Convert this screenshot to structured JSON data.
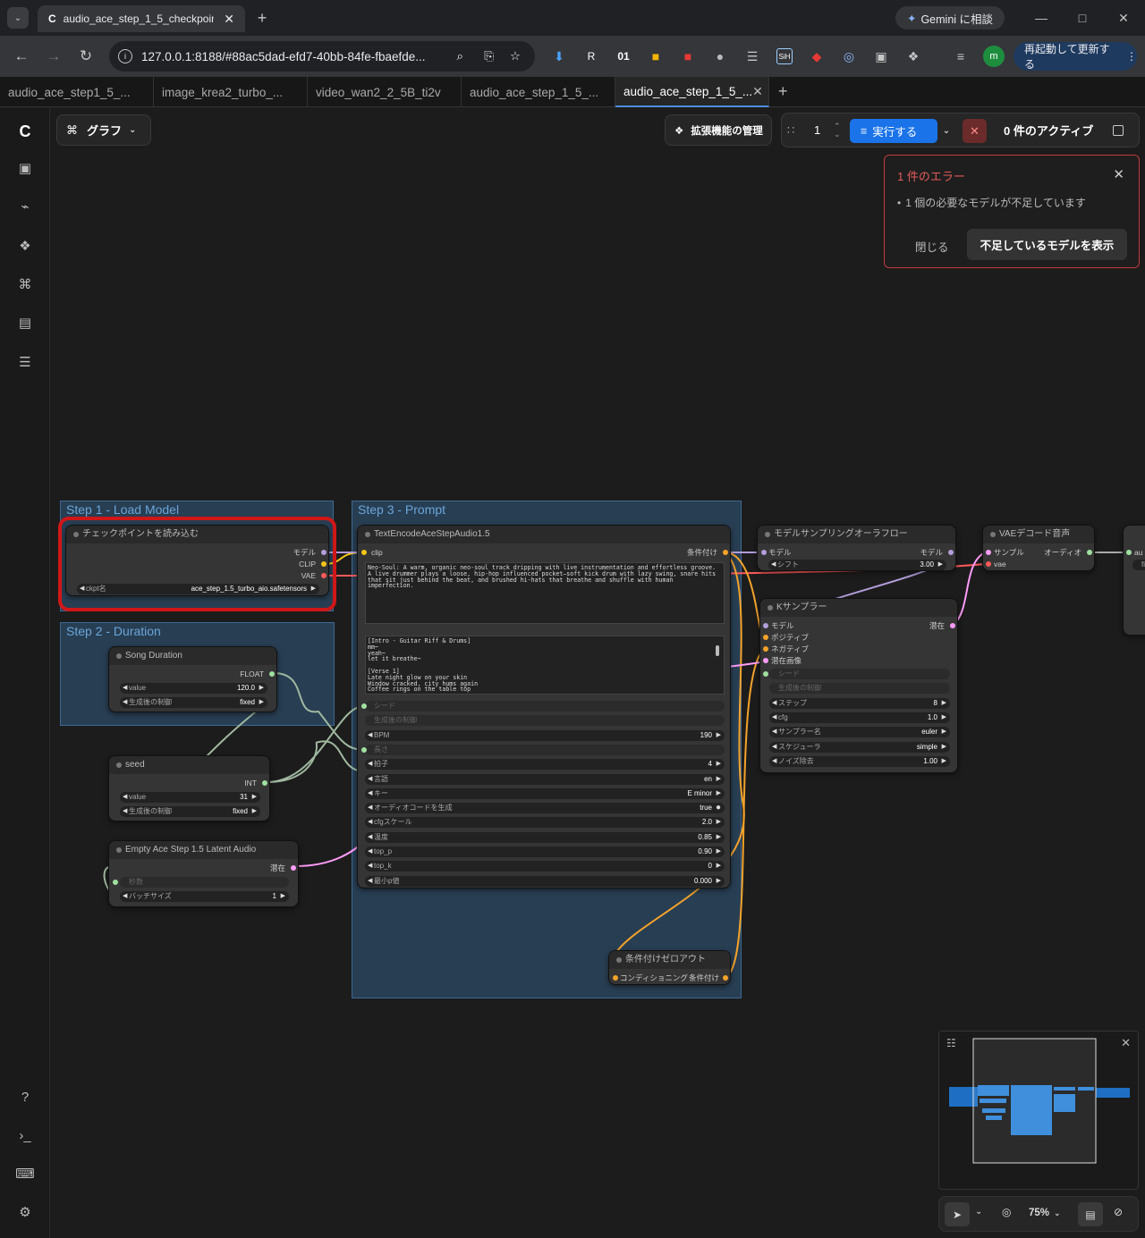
{
  "browser": {
    "tabs": [
      {
        "title": "audio_ace_step_1_5_checkpoint"
      }
    ],
    "new_tab": "+",
    "gemini_label": "Gemini に相談",
    "url": "127.0.0.1:8188/#88ac5dad-efd7-40bb-84fe-fbaefde...",
    "restart_label": "再起動して更新する",
    "profile_initial": "m",
    "ext_label_01": "01",
    "ext_label_sih": "SiH"
  },
  "workflow_tabs": [
    {
      "label": "audio_ace_step1_5_..."
    },
    {
      "label": "image_krea2_turbo_..."
    },
    {
      "label": "video_wan2_2_5B_ti2v"
    },
    {
      "label": "audio_ace_step_1_5_..."
    },
    {
      "label": "audio_ace_step_1_5_..."
    }
  ],
  "topbar": {
    "graph_label": "グラフ",
    "extensions_label": "拡張機能の管理",
    "batch_count": "1",
    "run_label": "実行する",
    "active_label": "0 件のアクティブ"
  },
  "error_panel": {
    "title": "1 件のエラー",
    "message": "1 個の必要なモデルが不足しています",
    "close_label": "閉じる",
    "show_label": "不足しているモデルを表示"
  },
  "groups": {
    "load_model": "Step 1 - Load Model",
    "duration": "Step 2 - Duration",
    "prompt": "Step 3 - Prompt"
  },
  "nodes": {
    "checkpoint": {
      "title": "チェックポイントを読み込む",
      "out_model": "モデル",
      "out_clip": "CLIP",
      "out_vae": "VAE",
      "ckpt_label": "ckpt名",
      "ckpt_value": "ace_step_1.5_turbo_aio.safetensors"
    },
    "song_duration": {
      "title": "Song Duration",
      "out": "FLOAT",
      "value_label": "value",
      "value": "120.0",
      "control_label": "生成後の制御",
      "control_value": "fixed"
    },
    "seed": {
      "title": "seed",
      "out": "INT",
      "value_label": "value",
      "value": "31",
      "control_label": "生成後の制御",
      "control_value": "fixed"
    },
    "latent": {
      "title": "Empty Ace Step 1.5 Latent Audio",
      "out": "潜在",
      "seconds_label": "秒数",
      "batch_label": "バッチサイズ",
      "batch_value": "1"
    },
    "text_encode": {
      "title": "TextEncodeAceStepAudio1.5",
      "in_clip": "clip",
      "out": "条件付け",
      "tags": "Neo-Soul: A warm, organic neo-soul track dripping with live instrumentation and effortless groove. A live drummer plays a loose, hip-hop influenced pocket—soft kick drum with lazy swing, snare hits that sit just behind the beat, and brushed hi-hats that breathe and shuffle with human imperfection.",
      "lyrics": "[Intro - Guitar Riff & Drums]\nmm~\nyeah~\nlet it breathe~\n\n[Verse 1]\nLate night glow on your skin\nWindow cracked, city hums again\nCoffee rings on the table top",
      "widgets": [
        {
          "label": "シード",
          "value": "",
          "dim": true
        },
        {
          "label": "生成後の制御",
          "value": "",
          "dim": true
        },
        {
          "label": "BPM",
          "value": "190"
        },
        {
          "label": "長さ",
          "value": "",
          "dim": true
        },
        {
          "label": "拍子",
          "value": "4"
        },
        {
          "label": "言語",
          "value": "en"
        },
        {
          "label": "キー",
          "value": "E minor"
        },
        {
          "label": "オーディオコードを生成",
          "value": "true",
          "toggle": true
        },
        {
          "label": "cfgスケール",
          "value": "2.0"
        },
        {
          "label": "温度",
          "value": "0.85"
        },
        {
          "label": "top_p",
          "value": "0.90"
        },
        {
          "label": "top_k",
          "value": "0"
        },
        {
          "label": "最小p値",
          "value": "0.000"
        }
      ]
    },
    "cond_zero": {
      "title": "条件付けゼロアウト",
      "in": "コンディショニング",
      "out": "条件付け"
    },
    "model_sampling": {
      "title": "モデルサンプリングオーラフロー",
      "in_model": "モデル",
      "out_model": "モデル",
      "shift_label": "シフト",
      "shift_value": "3.00"
    },
    "ksampler": {
      "title": "Kサンプラー",
      "in_model": "モデル",
      "in_pos": "ポジティブ",
      "in_neg": "ネガティブ",
      "in_latent": "潜在画像",
      "out": "潜在",
      "widgets": [
        {
          "label": "シード",
          "value": "",
          "dim": true
        },
        {
          "label": "生成後の制御",
          "value": "",
          "dim": true
        },
        {
          "label": "ステップ",
          "value": "8"
        },
        {
          "label": "cfg",
          "value": "1.0"
        },
        {
          "label": "サンプラー名",
          "value": "euler"
        },
        {
          "label": "スケジューラ",
          "value": "simple"
        },
        {
          "label": "ノイズ除去",
          "value": "1.00"
        }
      ]
    },
    "vae_decode": {
      "title": "VAEデコード音声",
      "in_samples": "サンプル",
      "in_vae": "vae",
      "out": "オーディオ"
    },
    "partial": {
      "in": "au",
      "widget": "fi"
    }
  },
  "zoom": "75%",
  "colors": {
    "accent": "#1a73e8",
    "error": "#c23c3c",
    "group": "#3d6a94",
    "link_model": "#b39ddb",
    "link_clip": "#f5c518",
    "link_vae": "#ff5a5a",
    "link_cond": "#f4a32a",
    "link_latent": "#ff9cf9",
    "link_number": "#a0b8a0",
    "link_audio": "#aaaaaa"
  }
}
